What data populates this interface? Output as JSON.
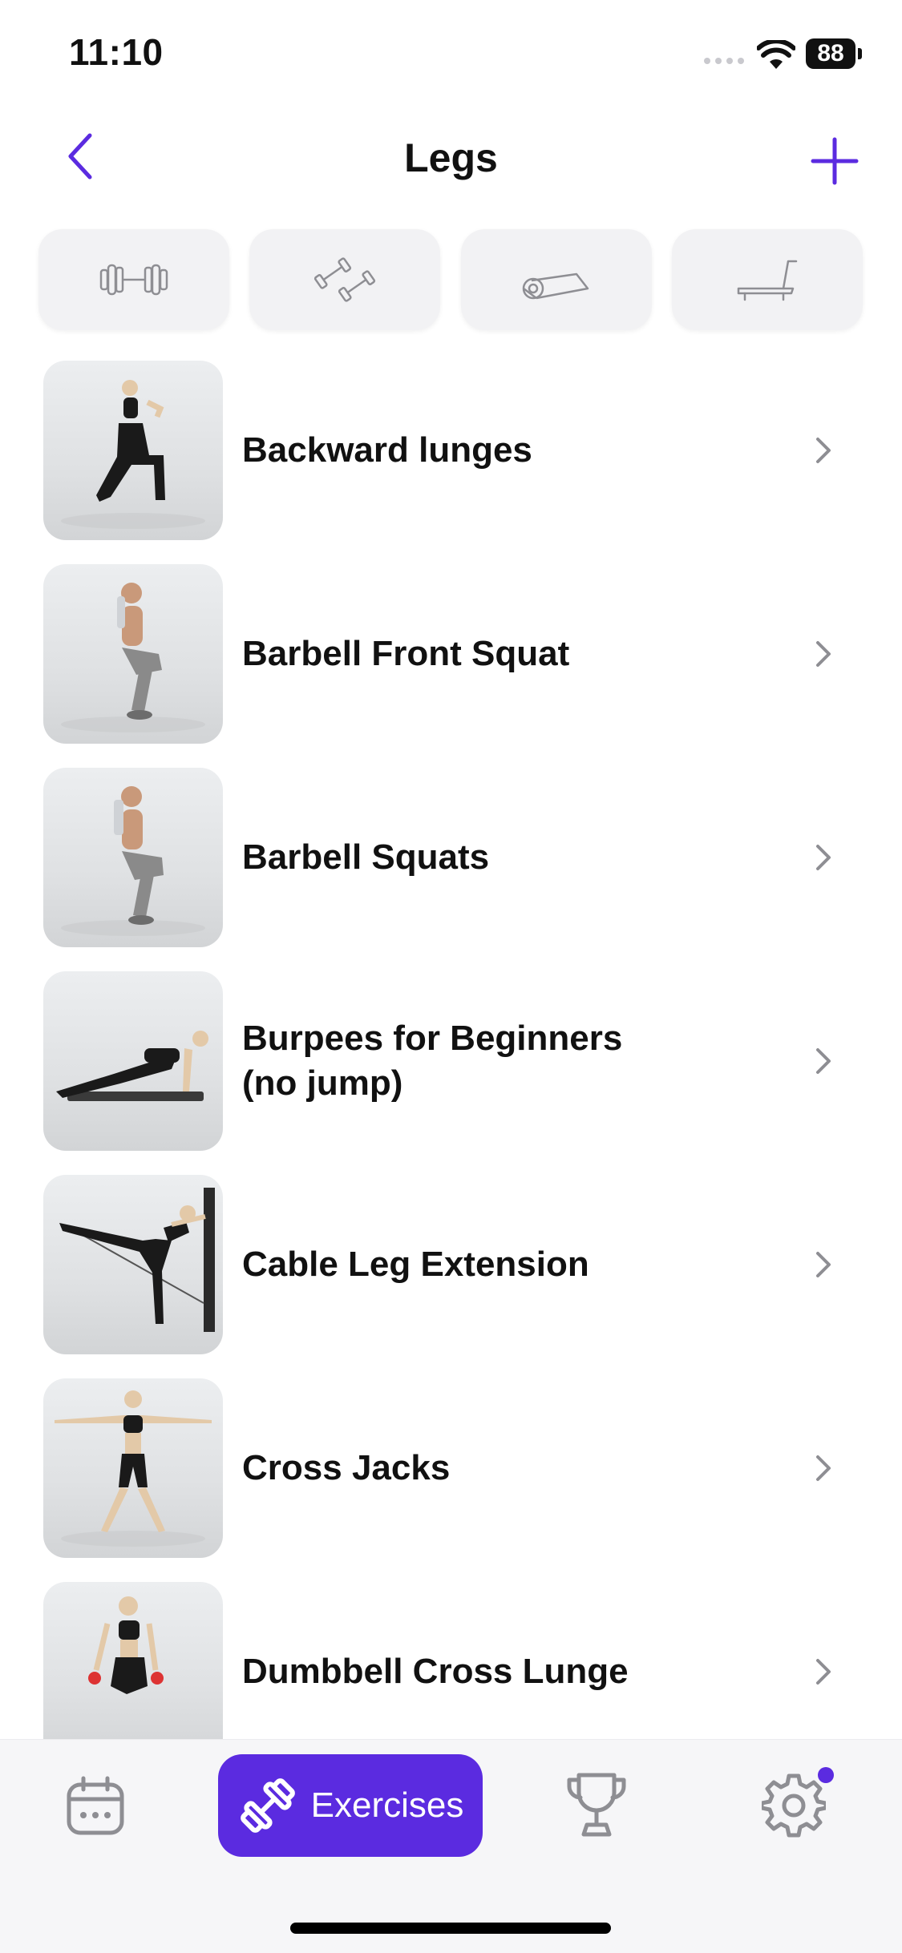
{
  "status": {
    "time": "11:10",
    "battery": "88"
  },
  "nav": {
    "title": "Legs"
  },
  "filters": [
    {
      "icon": "barbell-icon"
    },
    {
      "icon": "dumbbells-icon"
    },
    {
      "icon": "yoga-mat-icon"
    },
    {
      "icon": "treadmill-icon"
    }
  ],
  "exercises": [
    {
      "name": "Backward lunges"
    },
    {
      "name": "Barbell Front Squat"
    },
    {
      "name": "Barbell Squats"
    },
    {
      "name": "Burpees for Beginners\n(no jump)"
    },
    {
      "name": "Cable Leg Extension"
    },
    {
      "name": "Cross Jacks"
    },
    {
      "name": "Dumbbell Cross Lunge"
    }
  ],
  "tabbar": {
    "exercises_label": "Exercises"
  },
  "colors": {
    "accent": "#5b2be0",
    "icon_gray": "#8e8e93",
    "filter_bg": "#f2f2f4"
  }
}
